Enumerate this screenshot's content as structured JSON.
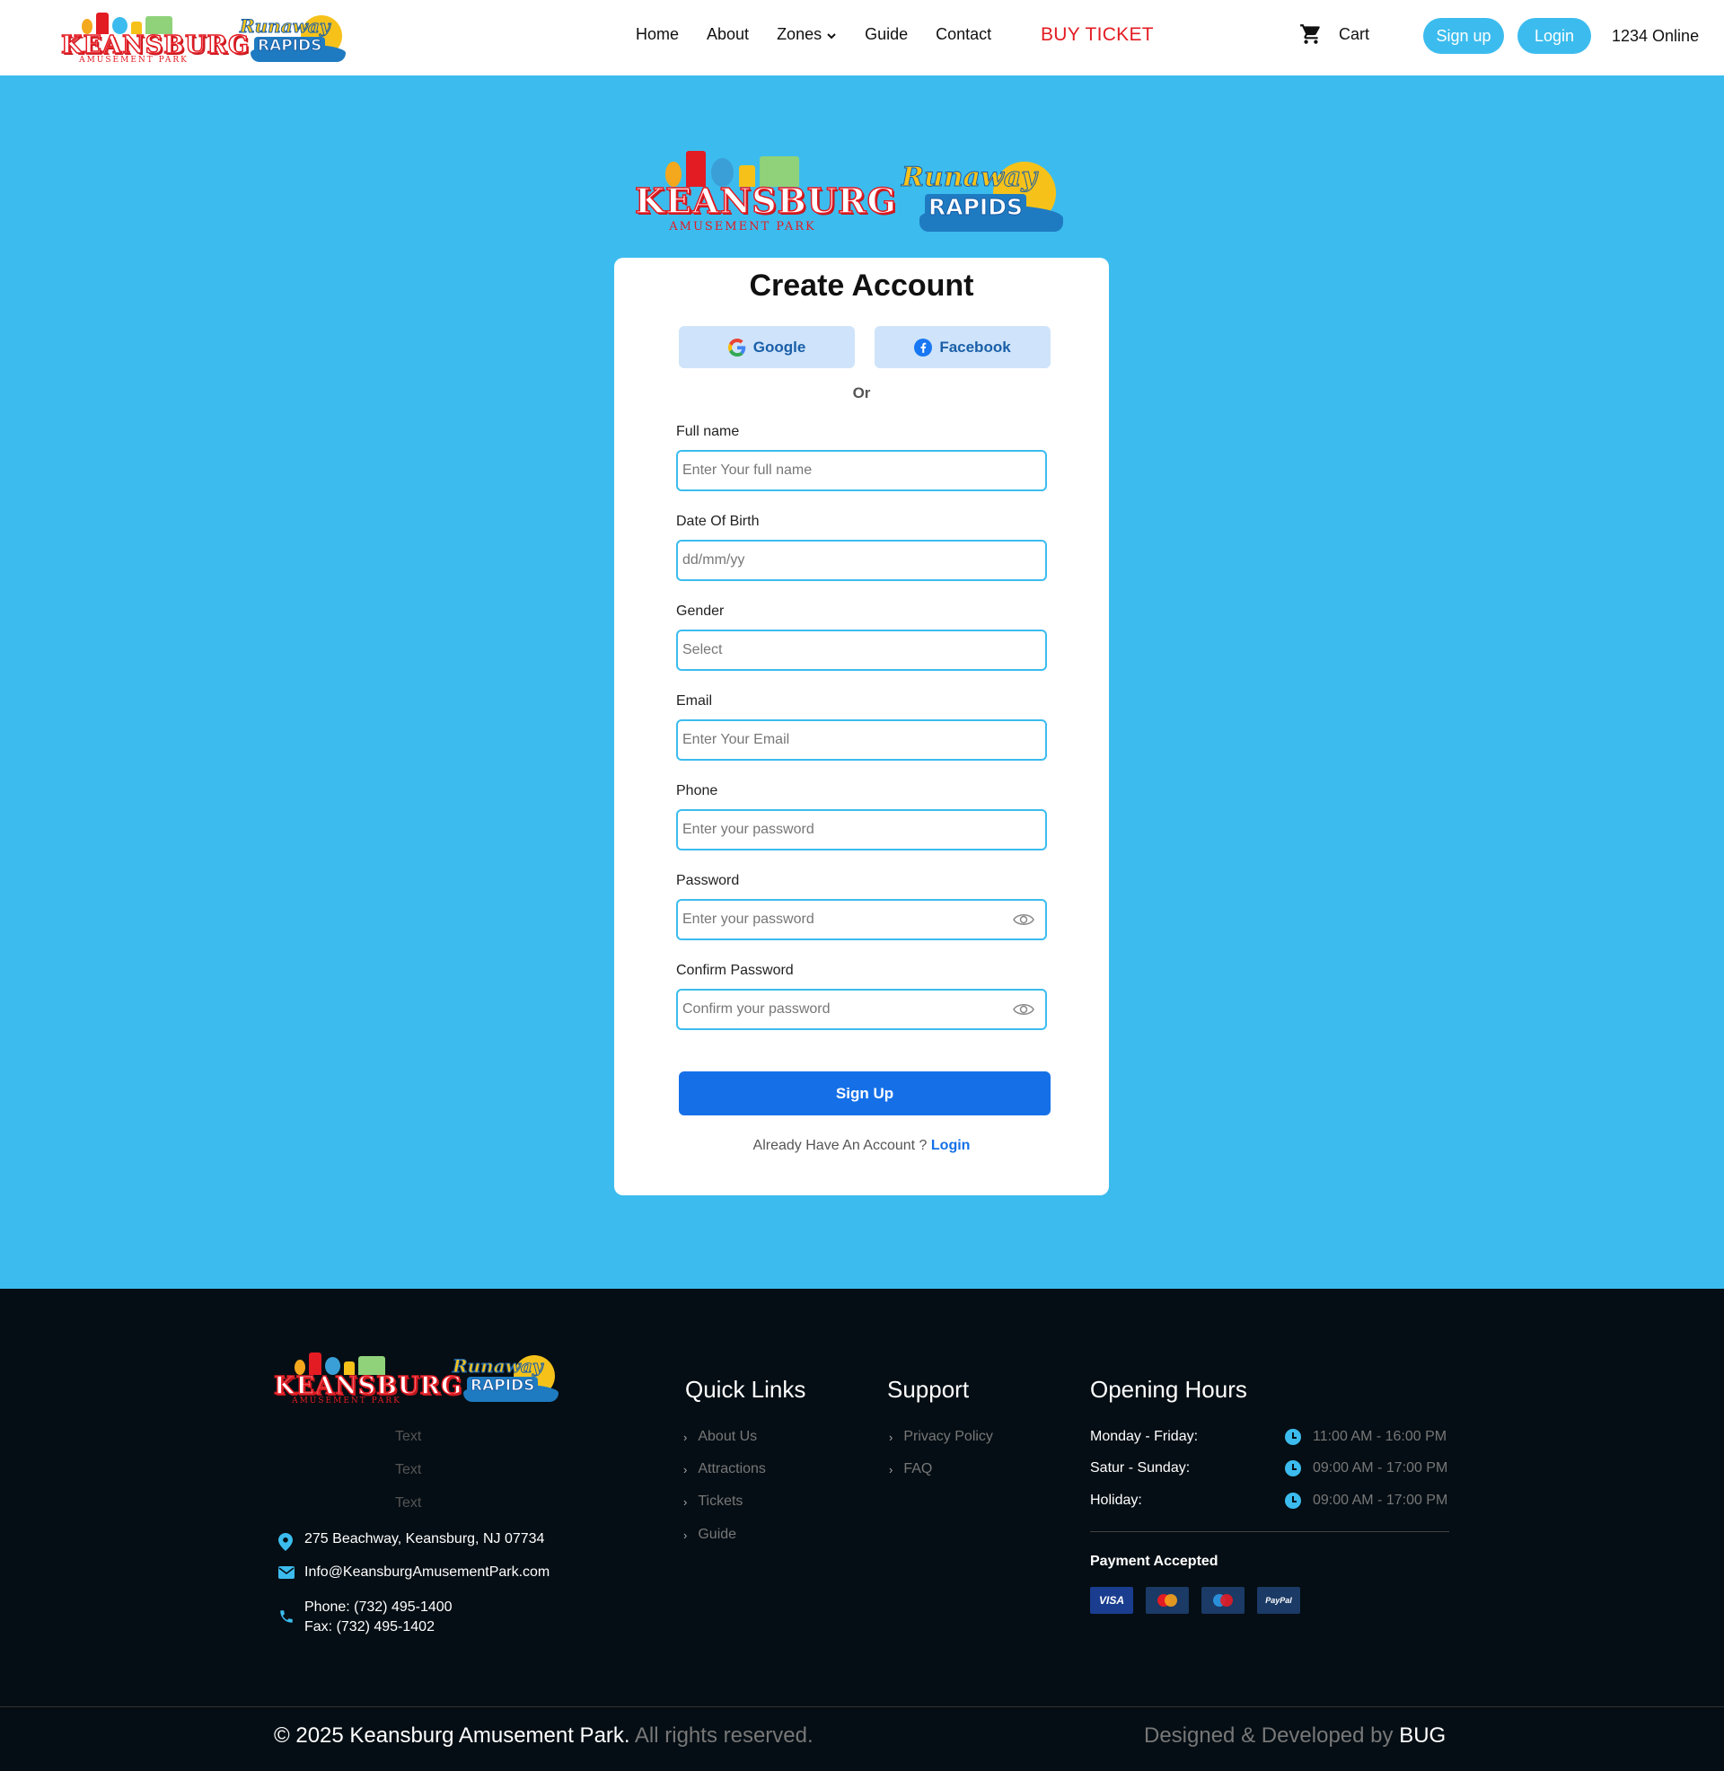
{
  "nav": {
    "logo_keansburg": {
      "title": "KEANSBURG",
      "subtitle": "AMUSEMENT PARK"
    },
    "logo_rapids": {
      "title1": "Runaway",
      "title2": "RAPIDS"
    },
    "links": [
      "Home",
      "About",
      "Zones",
      "Guide",
      "Contact"
    ],
    "buy_ticket": "BUY TICKET",
    "cart": "Cart",
    "signup": "Sign up",
    "login": "Login",
    "online": "1234 Online"
  },
  "hero_logos": {
    "keansburg": {
      "title": "KEANSBURG",
      "subtitle": "AMUSEMENT PARK"
    },
    "rapids": {
      "title1": "Runaway",
      "title2": "RAPIDS"
    }
  },
  "card": {
    "title": "Create Account",
    "google": "Google",
    "facebook": "Facebook",
    "or": "Or",
    "fields": {
      "fullname": {
        "label": "Full name",
        "placeholder": "Enter Your full name"
      },
      "dob": {
        "label": "Date Of Birth",
        "placeholder": "dd/mm/yy"
      },
      "gender": {
        "label": "Gender",
        "placeholder": "Select"
      },
      "email": {
        "label": "Email",
        "placeholder": "Enter Your Email"
      },
      "phone": {
        "label": "Phone",
        "placeholder": "Enter your password"
      },
      "password": {
        "label": "Password",
        "placeholder": "Enter your password"
      },
      "confirm": {
        "label": "Confirm Password",
        "placeholder": "Confirm your password"
      }
    },
    "submit": "Sign Up",
    "already_text": "Already Have An Account ?",
    "already_link": "Login"
  },
  "footer": {
    "logo_keansburg": {
      "title": "KEANSBURG",
      "subtitle": "AMUSEMENT PARK"
    },
    "logo_rapids": {
      "title1": "Runaway",
      "title2": "RAPIDS"
    },
    "texts": [
      "Text",
      "Text",
      "Text"
    ],
    "address": "275 Beachway, Keansburg, NJ 07734",
    "email": "Info@KeansburgAmusementPark.com",
    "phone": "Phone: (732) 495-1400",
    "fax": "Fax: (732) 495-1402",
    "quick_links_title": "Quick Links",
    "quick_links": [
      "About Us",
      "Attractions",
      "Tickets",
      "Guide"
    ],
    "support_title": "Support",
    "support_links": [
      "Privacy Policy",
      "FAQ"
    ],
    "hours_title": "Opening Hours",
    "hours": [
      {
        "day": "Monday - Friday:",
        "time": "11:00 AM - 16:00 PM"
      },
      {
        "day": "Satur - Sunday:",
        "time": "09:00 AM - 17:00 PM"
      },
      {
        "day": "Holiday:",
        "time": "09:00 AM - 17:00 PM"
      }
    ],
    "payment_title": "Payment Accepted",
    "payment_cards": [
      {
        "name": "VISA",
        "color": "#1a3d8f"
      },
      {
        "name": "MasterCard",
        "color": "#1b3a66"
      },
      {
        "name": "Maestro",
        "color": "#1b3a66"
      },
      {
        "name": "PayPal",
        "color": "#1b3a66"
      }
    ],
    "copyright_main": "© 2025 Keansburg Amusement Park.",
    "copyright_muted": "All rights reserved.",
    "designed_text": "Designed & Developed by",
    "designed_by": "BUG"
  },
  "colors": {
    "background": "#3cbcee",
    "primary_button": "#1570e8",
    "buy_ticket": "#e31b23",
    "footer_bg": "#050e14"
  }
}
